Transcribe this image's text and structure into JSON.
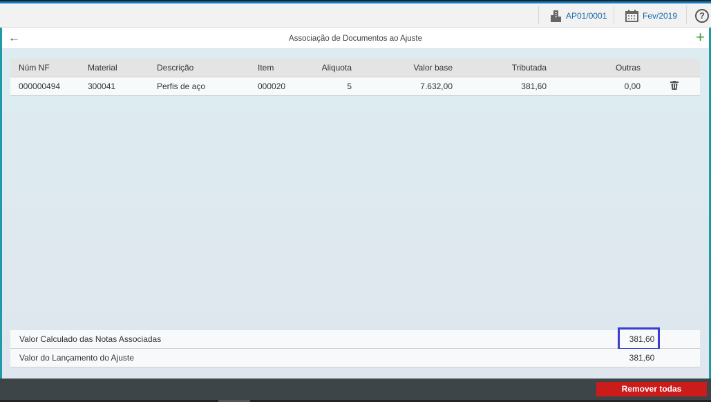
{
  "shell": {
    "company": "AP01/0001",
    "period": "Fev/2019",
    "help": "?"
  },
  "page": {
    "title": "Associação de Documentos ao Ajuste"
  },
  "table": {
    "headers": [
      "Núm NF",
      "Material",
      "Descrição",
      "Item",
      "Aliquota",
      "Valor base",
      "Tributada",
      "Outras"
    ],
    "rows": [
      [
        "000000494",
        "300041",
        "Perfis de aço",
        "000020",
        "5",
        "7.632,00",
        "381,60",
        "0,00"
      ]
    ]
  },
  "summary": [
    {
      "label": "Valor Calculado das Notas Associadas",
      "value": "381,60"
    },
    {
      "label": "Valor do Lançamento do Ajuste",
      "value": "381,60"
    }
  ],
  "footer": {
    "remove_all": "Remover todas"
  }
}
